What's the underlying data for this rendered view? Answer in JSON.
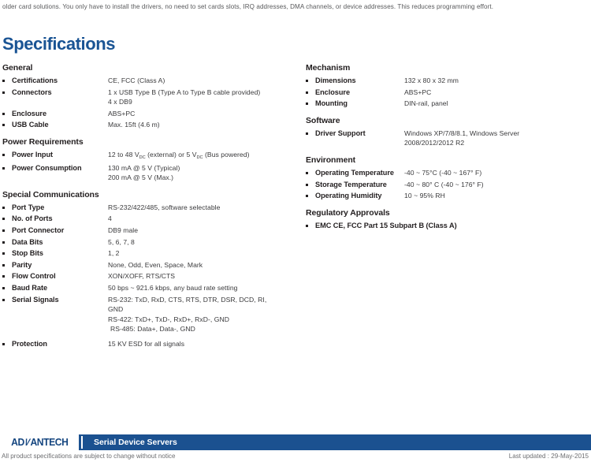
{
  "intro": {
    "paragraph": "older card solutions. You only have to install the drivers, no need to set cards slots, IRQ addresses, DMA channels, or device addresses. This reduces programming effort."
  },
  "page": {
    "spec_title": "Specifications",
    "accent_blue": "#1a5494",
    "footer_blue": "#1b5190",
    "text_color": "#231f20"
  },
  "left_column": [
    {
      "heading": "General",
      "rows": [
        {
          "label": "Certifications",
          "lines": [
            "CE, FCC (Class A)"
          ]
        },
        {
          "label": "Connectors",
          "lines": [
            "1 x USB Type B (Type A to Type B cable provided)",
            "4 x DB9"
          ]
        },
        {
          "label": "Enclosure",
          "lines": [
            "ABS+PC"
          ]
        },
        {
          "label": "USB Cable",
          "lines": [
            "Max. 15ft (4.6 m)"
          ]
        }
      ]
    },
    {
      "heading": "Power Requirements",
      "rows": [
        {
          "label": "Power Input",
          "html_lines": [
            "12 to 48 V<sub>DC</sub> (external) or 5 V<sub>DC</sub> (Bus powered)"
          ]
        },
        {
          "label": "Power Consumption",
          "lines": [
            "130 mA @ 5 V (Typical)",
            "200 mA @ 5 V (Max.)"
          ]
        }
      ]
    },
    {
      "heading": "Special Communications",
      "rows": [
        {
          "label": "Port Type",
          "lines": [
            "RS-232/422/485, software selectable"
          ]
        },
        {
          "label": "No. of Ports",
          "lines": [
            "4"
          ]
        },
        {
          "label": "Port Connector",
          "lines": [
            "DB9 male"
          ]
        },
        {
          "label": "Data Bits",
          "lines": [
            "5, 6, 7, 8"
          ]
        },
        {
          "label": "Stop Bits",
          "lines": [
            "1, 2"
          ]
        },
        {
          "label": "Parity",
          "lines": [
            "None, Odd, Even, Space, Mark"
          ]
        },
        {
          "label": "Flow Control",
          "lines": [
            "XON/XOFF, RTS/CTS"
          ]
        },
        {
          "label": "Baud Rate",
          "lines": [
            "50 bps ~ 921.6 kbps, any baud rate setting"
          ]
        },
        {
          "label": "Serial Signals",
          "lines": [
            "RS-232: TxD, RxD, CTS, RTS, DTR, DSR, DCD, RI,",
            "GND",
            "RS-422: TxD+, TxD-, RxD+, RxD-, GND",
            "RS-485: Data+, Data-, GND"
          ],
          "indent_lines": [
            3
          ]
        },
        {
          "label": "Protection",
          "lines": [
            "15 KV ESD for all signals"
          ],
          "spaced_above": true
        }
      ]
    }
  ],
  "right_column": [
    {
      "heading": "Mechanism",
      "rows": [
        {
          "label": "Dimensions",
          "lines": [
            "132 x 80 x 32 mm"
          ]
        },
        {
          "label": "Enclosure",
          "lines": [
            "ABS+PC"
          ]
        },
        {
          "label": "Mounting",
          "lines": [
            "DIN-rail, panel"
          ]
        }
      ]
    },
    {
      "heading": "Software",
      "rows": [
        {
          "label": "Driver Support",
          "lines": [
            "Windows XP/7/8/8.1, Windows Server",
            "2008/2012/2012 R2"
          ]
        }
      ]
    },
    {
      "heading": "Environment",
      "rows": [
        {
          "label": "Operating Temperature",
          "lines": [
            "-40 ~ 75°C (-40 ~ 167° F)"
          ]
        },
        {
          "label": "Storage Temperature",
          "lines": [
            "-40 ~ 80° C (-40 ~ 176° F)"
          ]
        },
        {
          "label": "Operating Humidity",
          "lines": [
            "10 ~ 95% RH"
          ]
        }
      ]
    },
    {
      "heading": "Regulatory Approvals",
      "rows": [
        {
          "label": "EMC  CE, FCC Part 15 Subpart B (Class A)",
          "lines": [],
          "all_bold": true
        }
      ]
    }
  ],
  "footer": {
    "logo_prefix": "AD",
    "logo_slash": "V",
    "logo_suffix": "ANTECH",
    "title": "Serial Device Servers",
    "disclaimer": "All product specifications are subject to change without notice",
    "last_updated": "Last updated : 29-May-2015"
  }
}
